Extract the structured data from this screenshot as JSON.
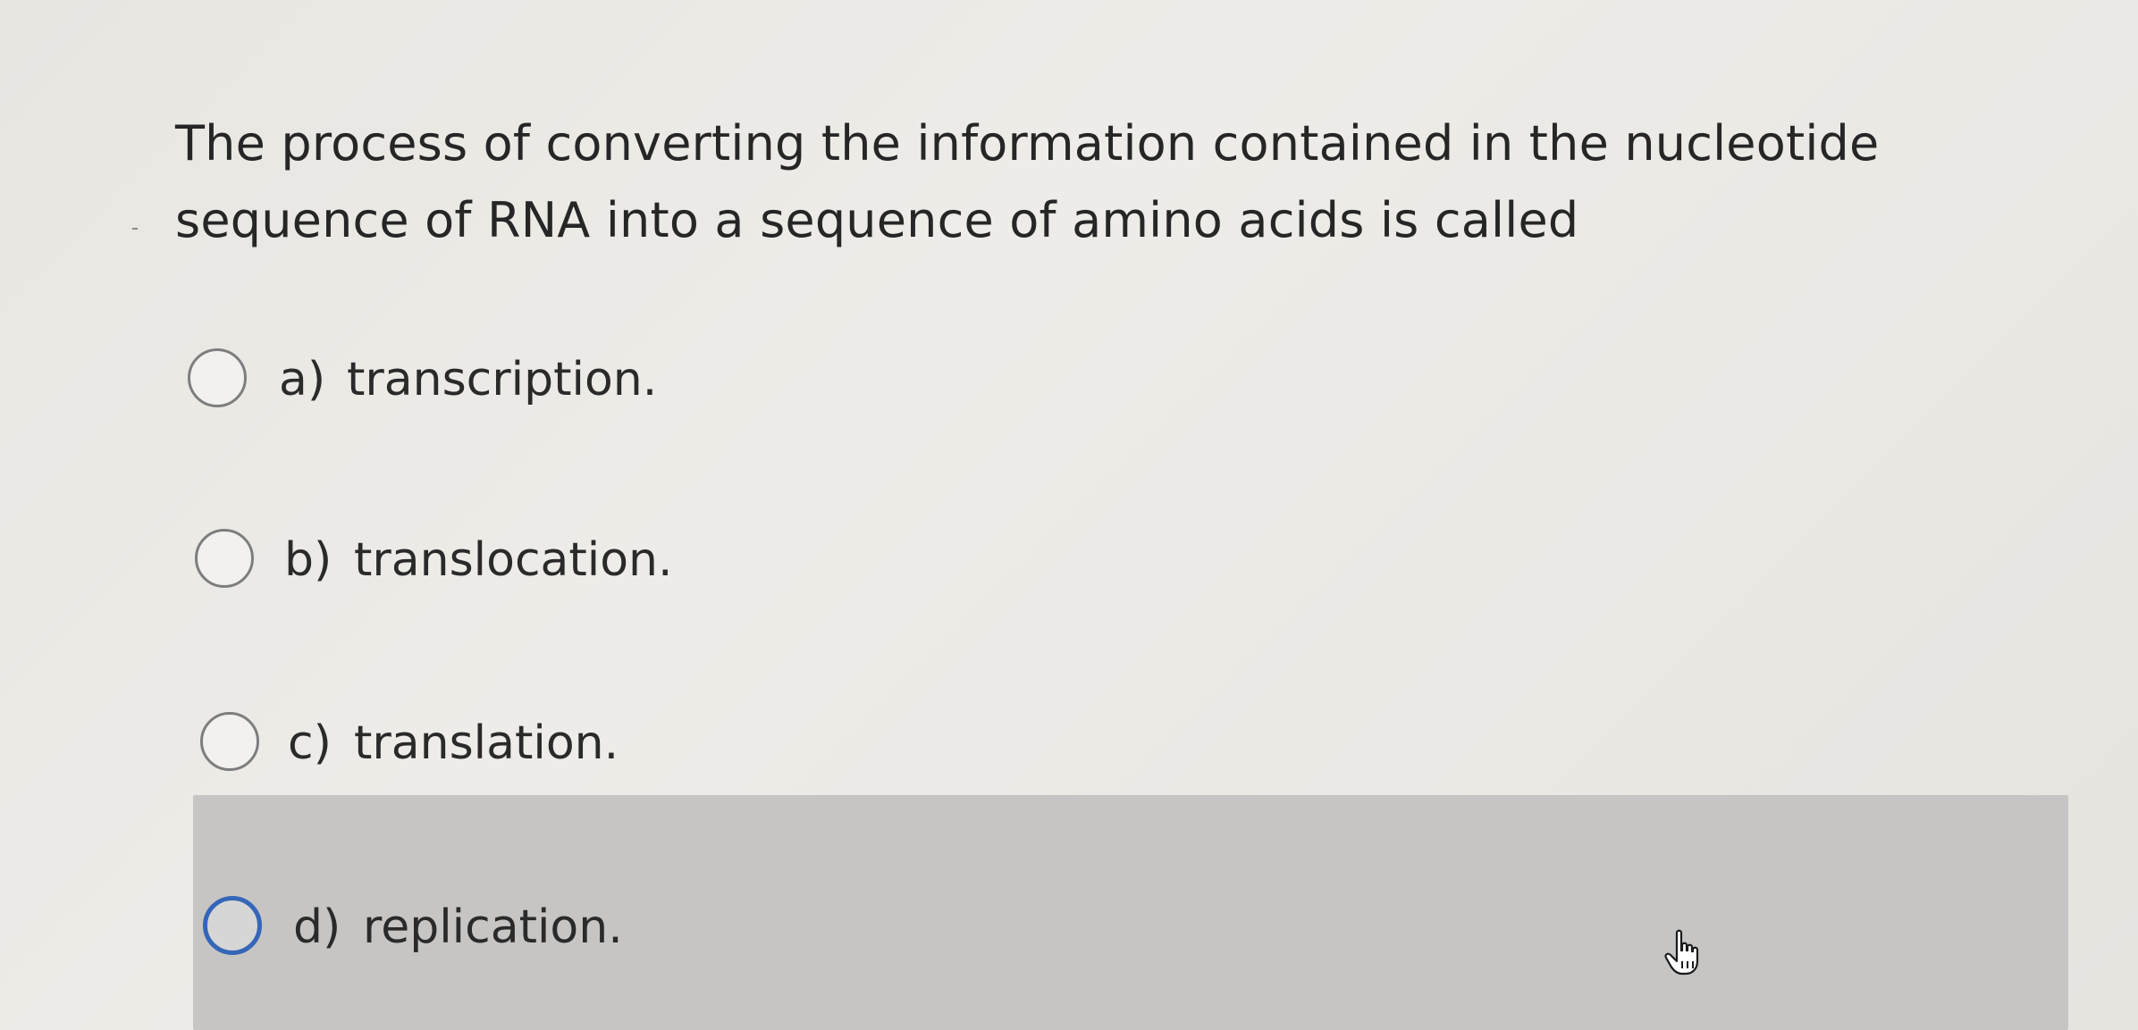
{
  "question": {
    "text": "The process of converting the information contained in the nucleotide sequence of RNA into a sequence of amino acids is called"
  },
  "options": [
    {
      "letter": "a)",
      "text": "transcription.",
      "selected": false
    },
    {
      "letter": "b)",
      "text": "translocation.",
      "selected": false
    },
    {
      "letter": "c)",
      "text": "translation.",
      "selected": false
    },
    {
      "letter": "d)",
      "text": "replication.",
      "hovered": true
    }
  ],
  "colors": {
    "hover_background": "#c6c5c3",
    "hover_radio_border": "#3566b8",
    "radio_border": "#7e7e7e"
  },
  "icons": {
    "cursor": "hand-pointer-icon"
  }
}
